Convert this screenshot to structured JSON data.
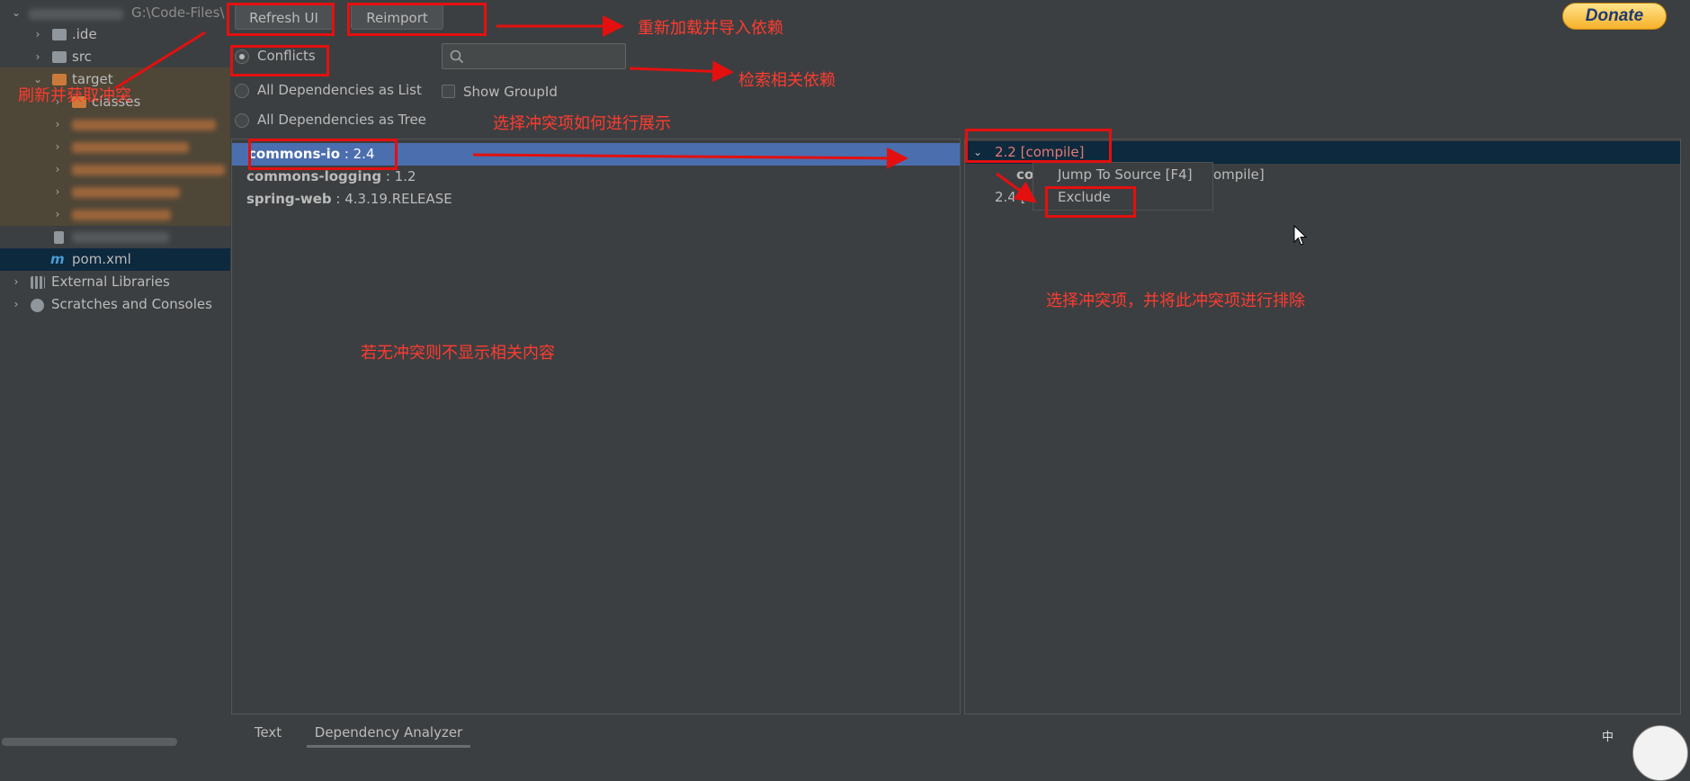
{
  "project_tree": {
    "root_path": "G:\\Code-Files\\",
    "items": [
      {
        "label": ".ide"
      },
      {
        "label": "src"
      },
      {
        "label": "target"
      },
      {
        "label": "classes"
      },
      {
        "label": "pom.xml"
      },
      {
        "label": "External Libraries"
      },
      {
        "label": "Scratches and Consoles"
      }
    ]
  },
  "toolbar": {
    "refresh_label": "Refresh UI",
    "reimport_label": "Reimport",
    "donate_label": "Donate"
  },
  "view_modes": [
    {
      "label": "Conflicts",
      "selected": true
    },
    {
      "label": "All Dependencies as List",
      "selected": false
    },
    {
      "label": "All Dependencies as Tree",
      "selected": false
    }
  ],
  "show_group_id": {
    "label": "Show GroupId",
    "checked": false
  },
  "search": {
    "placeholder": "",
    "value": ""
  },
  "conflicts": [
    {
      "name": "commons-io",
      "version": " : 2.4"
    },
    {
      "name": "commons-logging",
      "version": " : 1.2"
    },
    {
      "name": "spring-web",
      "version": " : 4.3.19.RELEASE"
    }
  ],
  "usages": {
    "header": "2.2 [compile]",
    "child_name": "co",
    "child_suffix": "ompile]",
    "second": "2.4 [c"
  },
  "context_menu": {
    "items": [
      "Jump To Source [F4]",
      "Exclude"
    ]
  },
  "bottom_tabs": [
    "Text",
    "Dependency Analyzer"
  ],
  "annotations": {
    "refresh_note": "刷新并获取冲突",
    "reimport_note": "重新加载并导入依赖",
    "search_note": "检索相关依赖",
    "mode_note": "选择冲突项如何进行展示",
    "empty_note": "若无冲突则不显示相关内容",
    "exclude_note": "选择冲突项，并将此冲突项进行排除"
  },
  "ime_indicator": "中",
  "colors": {
    "annotation": "#e3100f",
    "selection": "#4b6eaf",
    "background": "#3c3f41"
  }
}
